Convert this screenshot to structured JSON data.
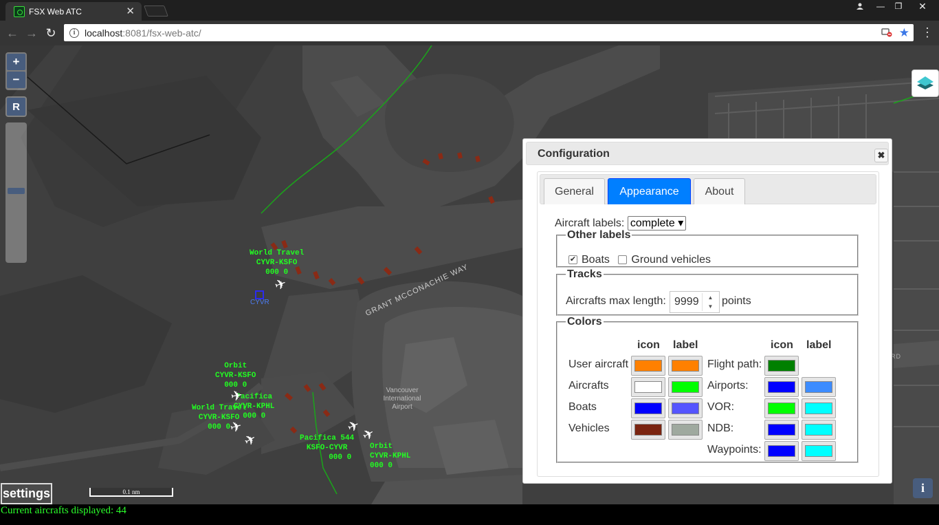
{
  "browser": {
    "tab_title": "FSX Web ATC",
    "url_host": "localhost",
    "url_rest": ":8081/fsx-web-atc/"
  },
  "map": {
    "aircraft": [
      {
        "callsign": "World Travel",
        "route": "CYVR-KSFO",
        "alt": "000 0"
      },
      {
        "callsign": "Orbit",
        "route": "CYVR-KSFO",
        "alt": "000 0"
      },
      {
        "callsign": "Pacifica",
        "route": "CYVR-KPHL",
        "alt": "000 0"
      },
      {
        "callsign": "World Travel",
        "route": "CYVR-KSFO",
        "alt": "000 0"
      },
      {
        "callsign": "Pacifica 544",
        "route": "KSFO-CYVR",
        "alt": "000 0"
      },
      {
        "callsign": "Orbit",
        "route": "CYVR-KPHL",
        "alt": "000 0"
      }
    ],
    "airport_code": "CYVR",
    "terminal_label": [
      "Vancouver",
      "International",
      "Airport"
    ],
    "road_label": "GRANT MCCONACHIE WAY",
    "road_label_right": "RD",
    "zoom_in": "+",
    "zoom_out": "−",
    "reset": "R",
    "settings": "settings",
    "scale": "0.1 nm",
    "info": "i",
    "status": "Current aircrafts displayed: 44"
  },
  "config": {
    "title": "Configuration",
    "close": "✖",
    "tabs": [
      "General",
      "Appearance",
      "About"
    ],
    "active_tab": "Appearance",
    "aircraft_labels_label": "Aircraft labels:",
    "aircraft_labels_value": "complete",
    "other_labels": {
      "legend": "Other labels",
      "boats": {
        "label": "Boats",
        "checked": true
      },
      "ground": {
        "label": "Ground vehicles",
        "checked": false
      }
    },
    "tracks": {
      "legend": "Tracks",
      "label": "Aircrafts max length:",
      "value": "9999",
      "unit": "points"
    },
    "colors": {
      "legend": "Colors",
      "col_icon": "icon",
      "col_label": "label",
      "left": [
        {
          "name": "User aircraft",
          "icon": "#ff8000",
          "label": "#ff8000"
        },
        {
          "name": "Aircrafts",
          "icon": "#ffffff",
          "label": "#00ff00"
        },
        {
          "name": "Boats",
          "icon": "#0000ff",
          "label": "#5555ff"
        },
        {
          "name": "Vehicles",
          "icon": "#7a2410",
          "label": "#9fa99f"
        }
      ],
      "right": [
        {
          "name": "Flight path:",
          "icon": "#008000",
          "label": null
        },
        {
          "name": "Airports:",
          "icon": "#0000ff",
          "label": "#3c8cff"
        },
        {
          "name": "VOR:",
          "icon": "#00ff00",
          "label": "#00ffff"
        },
        {
          "name": "NDB:",
          "icon": "#0000ff",
          "label": "#00ffff"
        },
        {
          "name": "Waypoints:",
          "icon": "#0000ff",
          "label": "#00ffff"
        }
      ]
    }
  }
}
